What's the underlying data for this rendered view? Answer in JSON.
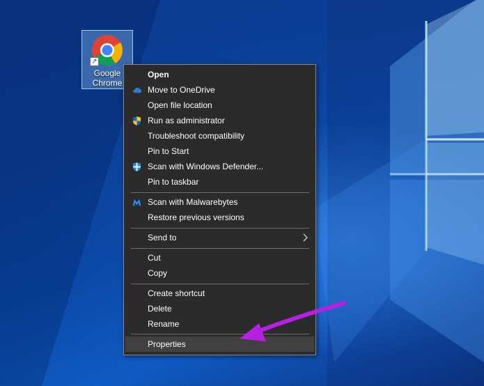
{
  "desktop": {
    "icon": {
      "label": "Google\nChrome",
      "icon_name": "chrome-icon"
    }
  },
  "context_menu": {
    "items": [
      {
        "id": "open",
        "label": "Open",
        "bold": true
      },
      {
        "id": "move-to-onedrive",
        "label": "Move to OneDrive",
        "icon": "onedrive-cloud-icon"
      },
      {
        "id": "open-file-location",
        "label": "Open file location"
      },
      {
        "id": "run-as-administrator",
        "label": "Run as administrator",
        "icon": "uac-shield-icon"
      },
      {
        "id": "troubleshoot-compatibility",
        "label": "Troubleshoot compatibility"
      },
      {
        "id": "pin-to-start",
        "label": "Pin to Start"
      },
      {
        "id": "scan-windows-defender",
        "label": "Scan with Windows Defender...",
        "icon": "defender-shield-icon"
      },
      {
        "id": "pin-to-taskbar",
        "label": "Pin to taskbar"
      },
      {
        "id": "scan-malwarebytes",
        "label": "Scan with Malwarebytes",
        "icon": "malwarebytes-icon"
      },
      {
        "id": "restore-previous-versions",
        "label": "Restore previous versions"
      },
      {
        "id": "send-to",
        "label": "Send to",
        "submenu": true
      },
      {
        "id": "cut",
        "label": "Cut"
      },
      {
        "id": "copy",
        "label": "Copy"
      },
      {
        "id": "create-shortcut",
        "label": "Create shortcut"
      },
      {
        "id": "delete",
        "label": "Delete"
      },
      {
        "id": "rename",
        "label": "Rename"
      },
      {
        "id": "properties",
        "label": "Properties",
        "highlighted": true
      }
    ]
  },
  "colors": {
    "menu_background": "#2b2b2b",
    "menu_text": "#ffffff",
    "menu_highlight": "#414141",
    "annotation_arrow": "#b620e0",
    "onedrive_blue": "#2b7cd3",
    "defender_blue": "#1e88e5"
  }
}
